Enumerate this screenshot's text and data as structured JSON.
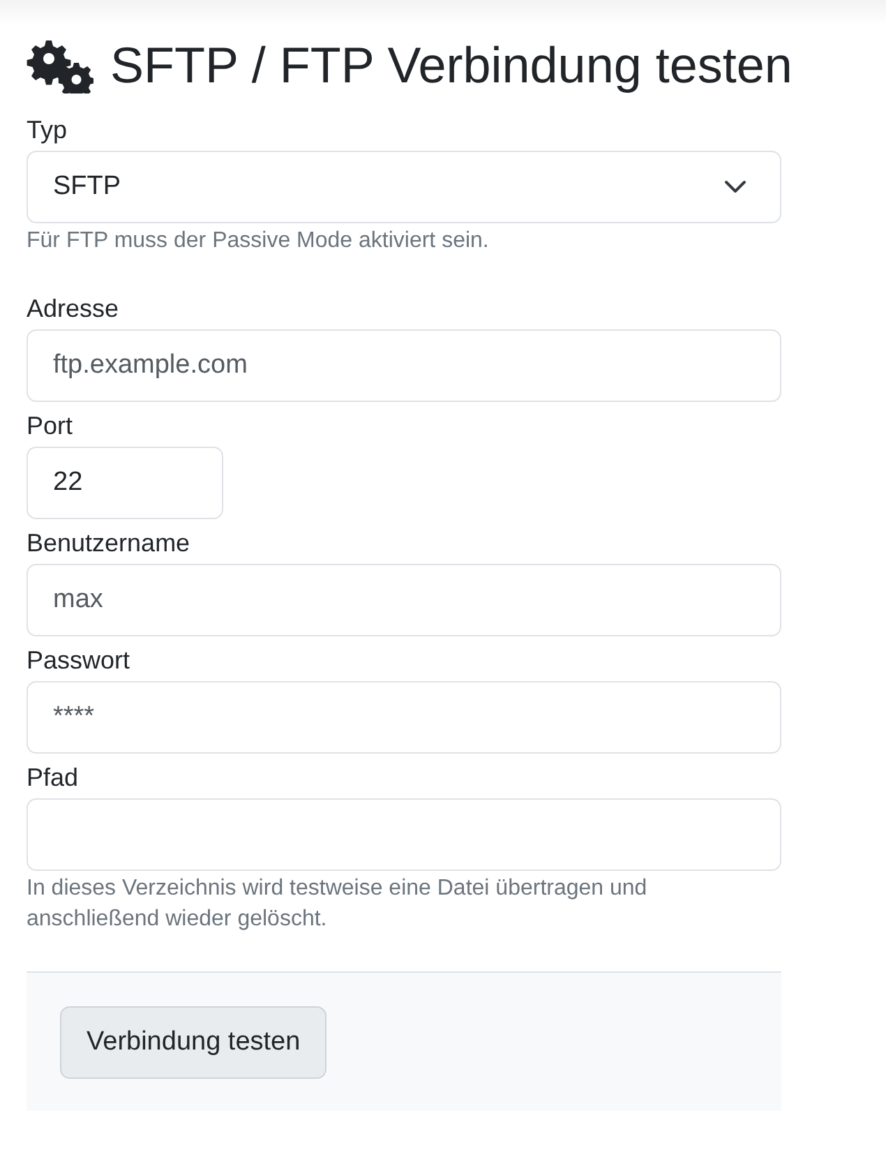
{
  "title": "SFTP / FTP Verbindung testen",
  "fields": [
    {
      "kind": "select",
      "label": "Typ",
      "value": "SFTP",
      "help": "Für FTP muss der Passive Mode aktiviert sein."
    },
    {
      "kind": "text",
      "label": "Adresse",
      "placeholder": "ftp.example.com"
    },
    {
      "kind": "number",
      "label": "Port",
      "value": "22"
    },
    {
      "kind": "text",
      "label": "Benutzername",
      "placeholder": "max"
    },
    {
      "kind": "password",
      "label": "Passwort",
      "placeholder": "****"
    },
    {
      "kind": "text",
      "label": "Pfad",
      "help": "In dieses Verzeichnis wird testweise eine Datei übertragen und anschließend wieder gelöscht."
    }
  ],
  "submit_button": "Verbindung testen"
}
